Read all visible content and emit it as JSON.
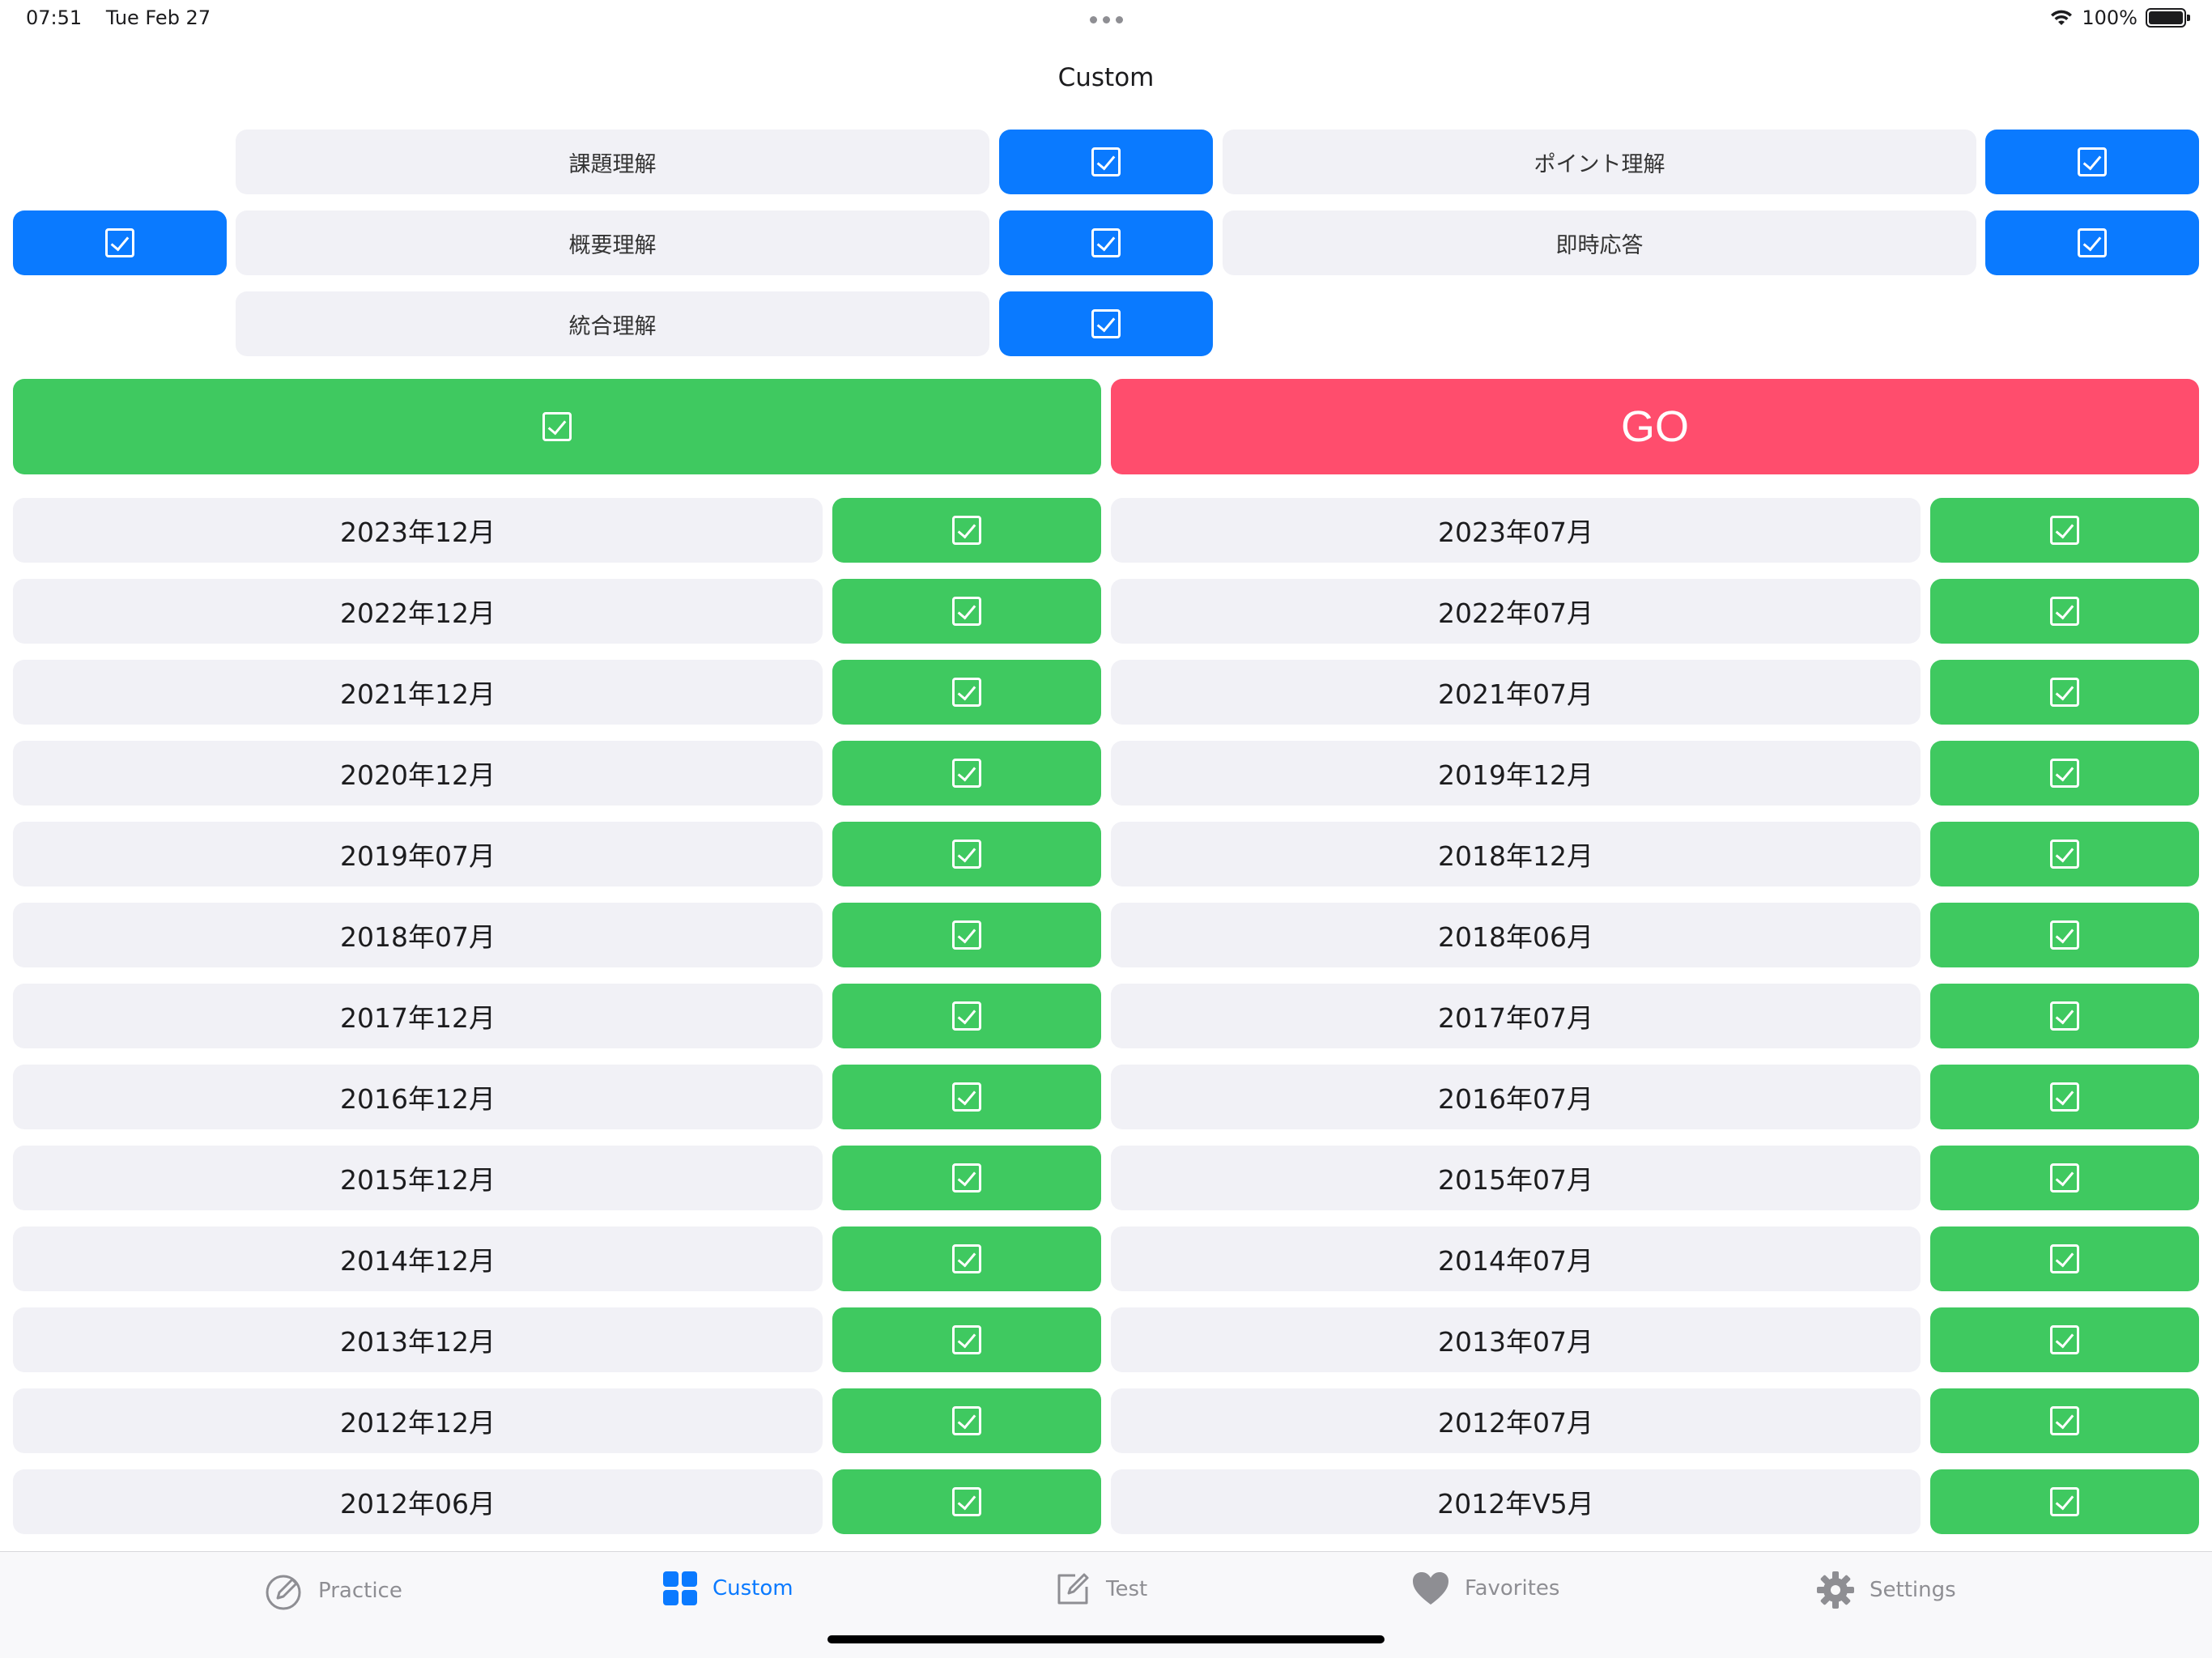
{
  "status": {
    "time": "07:51",
    "date": "Tue Feb 27",
    "battery": "100%"
  },
  "title": "Custom",
  "categories": [
    {
      "label": "課題理解"
    },
    {
      "label": "ポイント理解"
    },
    {
      "label": "概要理解"
    },
    {
      "label": "即時応答"
    },
    {
      "label": "統合理解"
    }
  ],
  "go_label": "GO",
  "years_left": [
    "2023年12月",
    "2022年12月",
    "2021年12月",
    "2020年12月",
    "2019年07月",
    "2018年07月",
    "2017年12月",
    "2016年12月",
    "2015年12月",
    "2014年12月",
    "2013年12月",
    "2012年12月",
    "2012年06月"
  ],
  "years_right": [
    "2023年07月",
    "2022年07月",
    "2021年07月",
    "2019年12月",
    "2018年12月",
    "2018年06月",
    "2017年07月",
    "2016年07月",
    "2015年07月",
    "2014年07月",
    "2013年07月",
    "2012年07月",
    "2012年V5月"
  ],
  "tabs": [
    {
      "label": "Practice",
      "icon": "pencil-circle-icon"
    },
    {
      "label": "Custom",
      "icon": "grid-icon",
      "active": true
    },
    {
      "label": "Test",
      "icon": "edit-square-icon"
    },
    {
      "label": "Favorites",
      "icon": "heart-icon"
    },
    {
      "label": "Settings",
      "icon": "gear-icon"
    }
  ],
  "colors": {
    "blue": "#0a7aff",
    "green": "#3fc960",
    "go": "#ff4d6d",
    "cell": "#f1f1f6"
  }
}
